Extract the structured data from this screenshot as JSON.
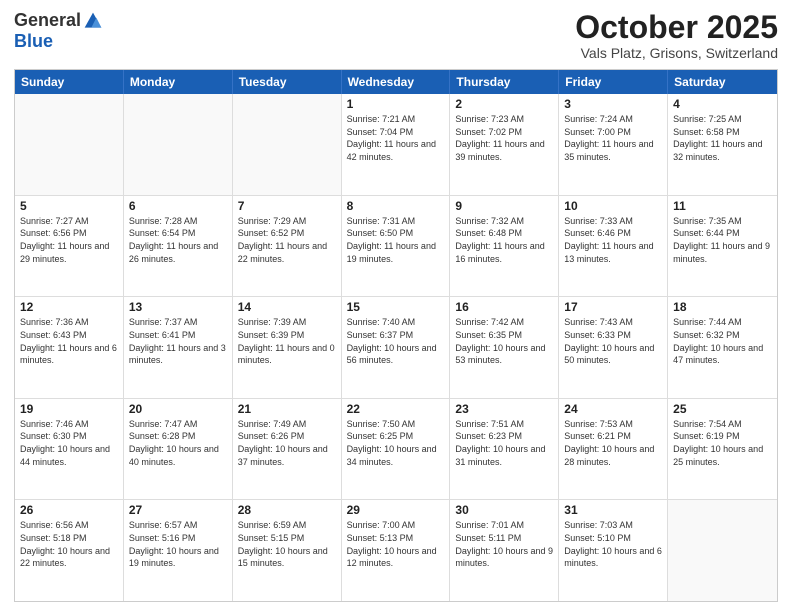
{
  "header": {
    "logo_general": "General",
    "logo_blue": "Blue",
    "month_title": "October 2025",
    "subtitle": "Vals Platz, Grisons, Switzerland"
  },
  "days_of_week": [
    "Sunday",
    "Monday",
    "Tuesday",
    "Wednesday",
    "Thursday",
    "Friday",
    "Saturday"
  ],
  "rows": [
    [
      {
        "day": "",
        "sunrise": "",
        "sunset": "",
        "daylight": "",
        "empty": true
      },
      {
        "day": "",
        "sunrise": "",
        "sunset": "",
        "daylight": "",
        "empty": true
      },
      {
        "day": "",
        "sunrise": "",
        "sunset": "",
        "daylight": "",
        "empty": true
      },
      {
        "day": "1",
        "sunrise": "Sunrise: 7:21 AM",
        "sunset": "Sunset: 7:04 PM",
        "daylight": "Daylight: 11 hours and 42 minutes."
      },
      {
        "day": "2",
        "sunrise": "Sunrise: 7:23 AM",
        "sunset": "Sunset: 7:02 PM",
        "daylight": "Daylight: 11 hours and 39 minutes."
      },
      {
        "day": "3",
        "sunrise": "Sunrise: 7:24 AM",
        "sunset": "Sunset: 7:00 PM",
        "daylight": "Daylight: 11 hours and 35 minutes."
      },
      {
        "day": "4",
        "sunrise": "Sunrise: 7:25 AM",
        "sunset": "Sunset: 6:58 PM",
        "daylight": "Daylight: 11 hours and 32 minutes."
      }
    ],
    [
      {
        "day": "5",
        "sunrise": "Sunrise: 7:27 AM",
        "sunset": "Sunset: 6:56 PM",
        "daylight": "Daylight: 11 hours and 29 minutes."
      },
      {
        "day": "6",
        "sunrise": "Sunrise: 7:28 AM",
        "sunset": "Sunset: 6:54 PM",
        "daylight": "Daylight: 11 hours and 26 minutes."
      },
      {
        "day": "7",
        "sunrise": "Sunrise: 7:29 AM",
        "sunset": "Sunset: 6:52 PM",
        "daylight": "Daylight: 11 hours and 22 minutes."
      },
      {
        "day": "8",
        "sunrise": "Sunrise: 7:31 AM",
        "sunset": "Sunset: 6:50 PM",
        "daylight": "Daylight: 11 hours and 19 minutes."
      },
      {
        "day": "9",
        "sunrise": "Sunrise: 7:32 AM",
        "sunset": "Sunset: 6:48 PM",
        "daylight": "Daylight: 11 hours and 16 minutes."
      },
      {
        "day": "10",
        "sunrise": "Sunrise: 7:33 AM",
        "sunset": "Sunset: 6:46 PM",
        "daylight": "Daylight: 11 hours and 13 minutes."
      },
      {
        "day": "11",
        "sunrise": "Sunrise: 7:35 AM",
        "sunset": "Sunset: 6:44 PM",
        "daylight": "Daylight: 11 hours and 9 minutes."
      }
    ],
    [
      {
        "day": "12",
        "sunrise": "Sunrise: 7:36 AM",
        "sunset": "Sunset: 6:43 PM",
        "daylight": "Daylight: 11 hours and 6 minutes."
      },
      {
        "day": "13",
        "sunrise": "Sunrise: 7:37 AM",
        "sunset": "Sunset: 6:41 PM",
        "daylight": "Daylight: 11 hours and 3 minutes."
      },
      {
        "day": "14",
        "sunrise": "Sunrise: 7:39 AM",
        "sunset": "Sunset: 6:39 PM",
        "daylight": "Daylight: 11 hours and 0 minutes."
      },
      {
        "day": "15",
        "sunrise": "Sunrise: 7:40 AM",
        "sunset": "Sunset: 6:37 PM",
        "daylight": "Daylight: 10 hours and 56 minutes."
      },
      {
        "day": "16",
        "sunrise": "Sunrise: 7:42 AM",
        "sunset": "Sunset: 6:35 PM",
        "daylight": "Daylight: 10 hours and 53 minutes."
      },
      {
        "day": "17",
        "sunrise": "Sunrise: 7:43 AM",
        "sunset": "Sunset: 6:33 PM",
        "daylight": "Daylight: 10 hours and 50 minutes."
      },
      {
        "day": "18",
        "sunrise": "Sunrise: 7:44 AM",
        "sunset": "Sunset: 6:32 PM",
        "daylight": "Daylight: 10 hours and 47 minutes."
      }
    ],
    [
      {
        "day": "19",
        "sunrise": "Sunrise: 7:46 AM",
        "sunset": "Sunset: 6:30 PM",
        "daylight": "Daylight: 10 hours and 44 minutes."
      },
      {
        "day": "20",
        "sunrise": "Sunrise: 7:47 AM",
        "sunset": "Sunset: 6:28 PM",
        "daylight": "Daylight: 10 hours and 40 minutes."
      },
      {
        "day": "21",
        "sunrise": "Sunrise: 7:49 AM",
        "sunset": "Sunset: 6:26 PM",
        "daylight": "Daylight: 10 hours and 37 minutes."
      },
      {
        "day": "22",
        "sunrise": "Sunrise: 7:50 AM",
        "sunset": "Sunset: 6:25 PM",
        "daylight": "Daylight: 10 hours and 34 minutes."
      },
      {
        "day": "23",
        "sunrise": "Sunrise: 7:51 AM",
        "sunset": "Sunset: 6:23 PM",
        "daylight": "Daylight: 10 hours and 31 minutes."
      },
      {
        "day": "24",
        "sunrise": "Sunrise: 7:53 AM",
        "sunset": "Sunset: 6:21 PM",
        "daylight": "Daylight: 10 hours and 28 minutes."
      },
      {
        "day": "25",
        "sunrise": "Sunrise: 7:54 AM",
        "sunset": "Sunset: 6:19 PM",
        "daylight": "Daylight: 10 hours and 25 minutes."
      }
    ],
    [
      {
        "day": "26",
        "sunrise": "Sunrise: 6:56 AM",
        "sunset": "Sunset: 5:18 PM",
        "daylight": "Daylight: 10 hours and 22 minutes."
      },
      {
        "day": "27",
        "sunrise": "Sunrise: 6:57 AM",
        "sunset": "Sunset: 5:16 PM",
        "daylight": "Daylight: 10 hours and 19 minutes."
      },
      {
        "day": "28",
        "sunrise": "Sunrise: 6:59 AM",
        "sunset": "Sunset: 5:15 PM",
        "daylight": "Daylight: 10 hours and 15 minutes."
      },
      {
        "day": "29",
        "sunrise": "Sunrise: 7:00 AM",
        "sunset": "Sunset: 5:13 PM",
        "daylight": "Daylight: 10 hours and 12 minutes."
      },
      {
        "day": "30",
        "sunrise": "Sunrise: 7:01 AM",
        "sunset": "Sunset: 5:11 PM",
        "daylight": "Daylight: 10 hours and 9 minutes."
      },
      {
        "day": "31",
        "sunrise": "Sunrise: 7:03 AM",
        "sunset": "Sunset: 5:10 PM",
        "daylight": "Daylight: 10 hours and 6 minutes."
      },
      {
        "day": "",
        "sunrise": "",
        "sunset": "",
        "daylight": "",
        "empty": true
      }
    ]
  ]
}
